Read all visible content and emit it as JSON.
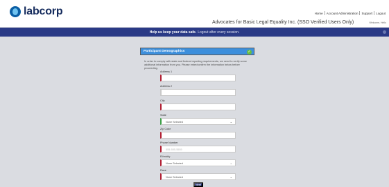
{
  "brand": {
    "logo_text": "labcorp",
    "primary_color": "#142a5c",
    "accent_color": "#2a3a86"
  },
  "topnav": {
    "items": [
      "Home",
      "Account Administration",
      "Support",
      "Logout"
    ]
  },
  "header": {
    "org_title": "Advocates for Basic Legal Equality Inc. (SSO Verified Users Only)",
    "welcome": "Welcome, Hello"
  },
  "banner": {
    "bold": "Help us keep your data safe.",
    "rest": "Logout after every session."
  },
  "form": {
    "title": "Participant Demographics",
    "intro": "In order to comply with state and federal reporting requirements, we need to verify some additional information from you. Please enter/confirm the information below before proceeding.",
    "fields": [
      {
        "label": "Address 1",
        "value": ""
      },
      {
        "label": "Address 2",
        "value": ""
      },
      {
        "label": "City",
        "value": ""
      },
      {
        "label": "State",
        "value": "None Selected"
      },
      {
        "label": "Zip Code",
        "value": ""
      },
      {
        "label": "Phone Number",
        "placeholder": "555-555-5555"
      },
      {
        "label": "Ethnicity",
        "value": "None Selected"
      },
      {
        "label": "Race",
        "value": "None Selected"
      }
    ],
    "next_label": "Next"
  }
}
